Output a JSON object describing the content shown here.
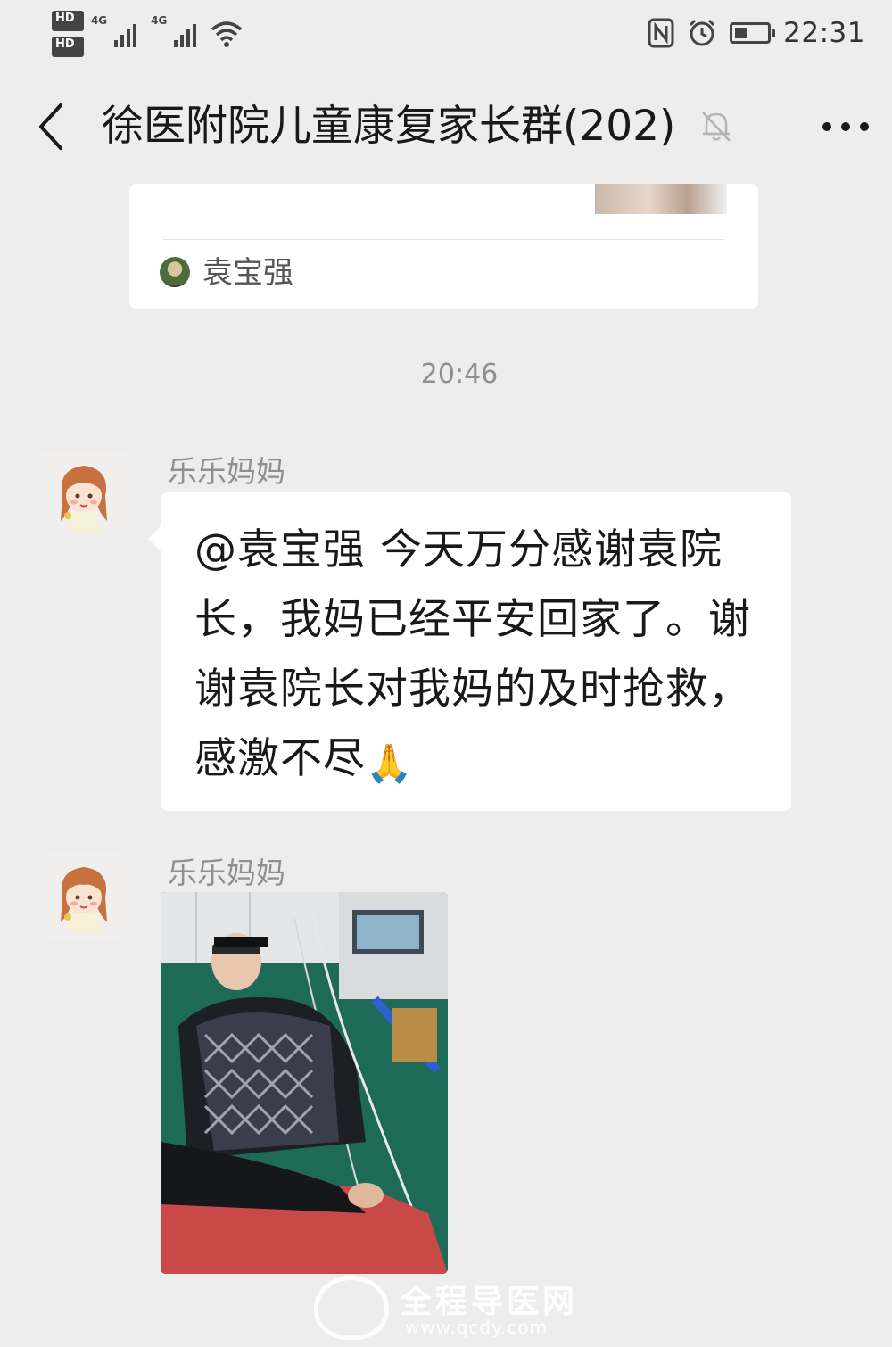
{
  "status_bar": {
    "sim1_badge": "HD",
    "sim1_index": "1",
    "sim2_badge": "HD",
    "sim2_index": "2",
    "network1": "4G",
    "network2": "4G",
    "battery_level": 0.4,
    "time": "22:31",
    "icons": [
      "nfc-icon",
      "alarm-icon",
      "battery-icon",
      "wifi-icon",
      "signal-icon"
    ]
  },
  "header": {
    "title": "徐医附院儿童康复家长群(202)",
    "back_icon": "chevron-left-icon",
    "mute_icon": "bell-off-icon",
    "more_icon": "more-dots-icon"
  },
  "link_card": {
    "source_name": "袁宝强"
  },
  "timestamp": "20:46",
  "messages": [
    {
      "sender": "乐乐妈妈",
      "text": "@袁宝强  今天万分感谢袁院长，我妈已经平安回家了。谢谢袁院长对我妈的及时抢救，感激不尽",
      "emoji": "🙏"
    },
    {
      "sender": "乐乐妈妈",
      "type": "image"
    }
  ],
  "watermark": {
    "name": "全程导医网",
    "url": "www.qcdy.com"
  },
  "colors": {
    "background": "#ededed",
    "bubble": "#ffffff",
    "text": "#191919",
    "muted": "#8f8f8f"
  }
}
